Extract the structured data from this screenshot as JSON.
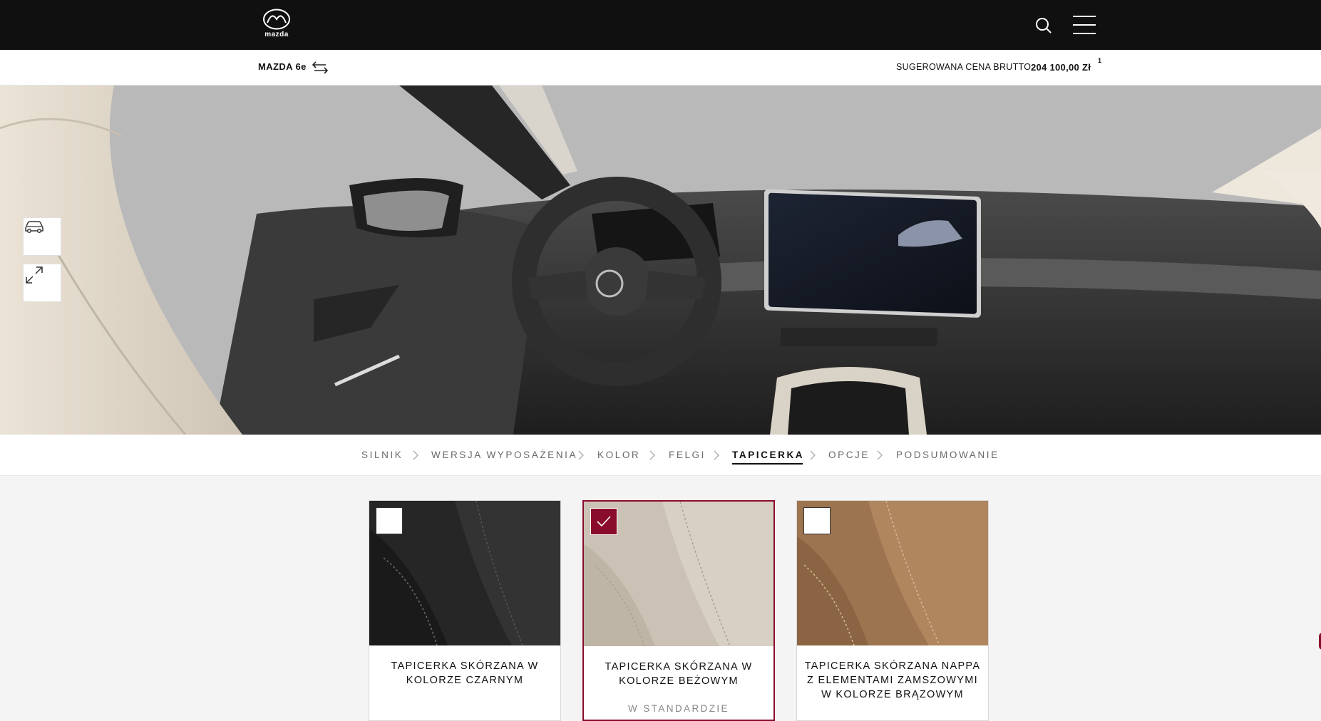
{
  "header": {
    "logo_text": "mazda",
    "logo_icon": "mazda-logo-icon",
    "search_icon": "search-icon",
    "menu_icon": "hamburger-menu-icon"
  },
  "model_bar": {
    "model_name": "MAZDA 6e",
    "swap_icon": "swap-arrows-icon",
    "price_label": "SUGEROWANA CENA BRUTTO",
    "price_value": "204 100,00 Zł",
    "price_footnote": "1"
  },
  "hero": {
    "view_toggle_icon": "car-exterior-icon",
    "fullscreen_icon": "expand-icon"
  },
  "steps": [
    {
      "label": "SILNIK",
      "active": false
    },
    {
      "label": "WERSJA WYPOSAŻENIA",
      "active": false
    },
    {
      "label": "KOLOR",
      "active": false
    },
    {
      "label": "FELGI",
      "active": false
    },
    {
      "label": "TAPICERKA",
      "active": true
    },
    {
      "label": "OPCJE",
      "active": false
    },
    {
      "label": "PODSUMOWANIE",
      "active": false
    }
  ],
  "upholstery": [
    {
      "title": "TAPICERKA SKÓRZANA W KOLORZE CZARNYM",
      "subtitle": "",
      "selected": false,
      "swatch": "#2a2a2a"
    },
    {
      "title": "TAPICERKA SKÓRZANA W KOLORZE BEŻOWYM",
      "subtitle": "W STANDARDZIE",
      "selected": true,
      "swatch": "#cdc4b8"
    },
    {
      "title": "TAPICERKA SKÓRZANA NAPPA Z ELEMENTAMI ZAMSZOWYMI W KOLORZE BRĄZOWYM",
      "subtitle": "",
      "selected": false,
      "swatch": "#a37a55"
    }
  ],
  "colors": {
    "accent": "#8a0c2c",
    "topbar": "#101010"
  }
}
